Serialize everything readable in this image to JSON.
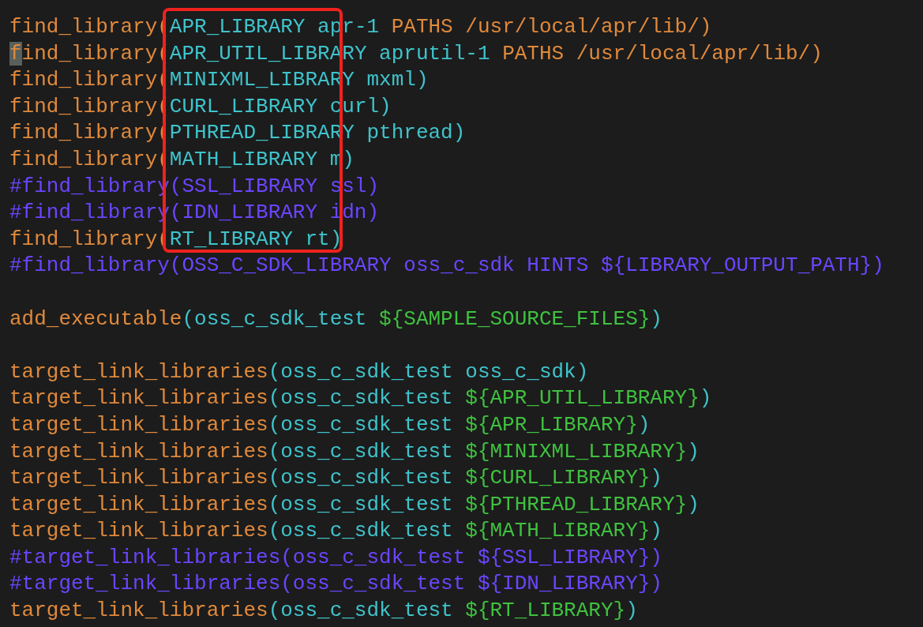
{
  "editor": {
    "lines": [
      {
        "kind": "code",
        "tokens": [
          {
            "kind": "function",
            "text": "find_library("
          },
          {
            "kind": "argument",
            "text": "APR_LIBRARY apr-1 "
          },
          {
            "kind": "keyword",
            "text": "PATHS /usr/local/apr/lib/)"
          }
        ]
      },
      {
        "kind": "code",
        "tokens": [
          {
            "kind": "cursor",
            "text": "f"
          },
          {
            "kind": "function",
            "text": "ind_library("
          },
          {
            "kind": "argument",
            "text": "APR_UTIL_LIBRARY aprutil-1 "
          },
          {
            "kind": "keyword",
            "text": "PATHS /usr/local/apr/lib/)"
          }
        ]
      },
      {
        "kind": "code",
        "tokens": [
          {
            "kind": "function",
            "text": "find_library("
          },
          {
            "kind": "argument",
            "text": "MINIXML_LIBRARY mxml)"
          }
        ]
      },
      {
        "kind": "code",
        "tokens": [
          {
            "kind": "function",
            "text": "find_library("
          },
          {
            "kind": "argument",
            "text": "CURL_LIBRARY curl)"
          }
        ]
      },
      {
        "kind": "code",
        "tokens": [
          {
            "kind": "function",
            "text": "find_library("
          },
          {
            "kind": "argument",
            "text": "PTHREAD_LIBRARY pthread)"
          }
        ]
      },
      {
        "kind": "code",
        "tokens": [
          {
            "kind": "function",
            "text": "find_library("
          },
          {
            "kind": "argument",
            "text": "MATH_LIBRARY m)"
          }
        ]
      },
      {
        "kind": "code",
        "tokens": [
          {
            "kind": "comment",
            "text": "#find_library(SSL_LIBRARY ssl)"
          }
        ]
      },
      {
        "kind": "code",
        "tokens": [
          {
            "kind": "comment",
            "text": "#find_library(IDN_LIBRARY idn)"
          }
        ]
      },
      {
        "kind": "code",
        "tokens": [
          {
            "kind": "function",
            "text": "find_library("
          },
          {
            "kind": "argument",
            "text": "RT_LIBRARY rt)"
          }
        ]
      },
      {
        "kind": "code",
        "tokens": [
          {
            "kind": "comment",
            "text": "#find_library(OSS_C_SDK_LIBRARY oss_c_sdk HINTS ${LIBRARY_OUTPUT_PATH})"
          }
        ]
      },
      {
        "kind": "blank"
      },
      {
        "kind": "code",
        "tokens": [
          {
            "kind": "function",
            "text": "add_executable"
          },
          {
            "kind": "argument",
            "text": "(oss_c_sdk_test "
          },
          {
            "kind": "variable",
            "text": "${SAMPLE_SOURCE_FILES}"
          },
          {
            "kind": "argument",
            "text": ")"
          }
        ]
      },
      {
        "kind": "blank"
      },
      {
        "kind": "code",
        "tokens": [
          {
            "kind": "function",
            "text": "target_link_libraries"
          },
          {
            "kind": "argument",
            "text": "(oss_c_sdk_test oss_c_sdk)"
          }
        ]
      },
      {
        "kind": "code",
        "tokens": [
          {
            "kind": "function",
            "text": "target_link_libraries"
          },
          {
            "kind": "argument",
            "text": "(oss_c_sdk_test "
          },
          {
            "kind": "variable",
            "text": "${APR_UTIL_LIBRARY}"
          },
          {
            "kind": "argument",
            "text": ")"
          }
        ]
      },
      {
        "kind": "code",
        "tokens": [
          {
            "kind": "function",
            "text": "target_link_libraries"
          },
          {
            "kind": "argument",
            "text": "(oss_c_sdk_test "
          },
          {
            "kind": "variable",
            "text": "${APR_LIBRARY}"
          },
          {
            "kind": "argument",
            "text": ")"
          }
        ]
      },
      {
        "kind": "code",
        "tokens": [
          {
            "kind": "function",
            "text": "target_link_libraries"
          },
          {
            "kind": "argument",
            "text": "(oss_c_sdk_test "
          },
          {
            "kind": "variable",
            "text": "${MINIXML_LIBRARY}"
          },
          {
            "kind": "argument",
            "text": ")"
          }
        ]
      },
      {
        "kind": "code",
        "tokens": [
          {
            "kind": "function",
            "text": "target_link_libraries"
          },
          {
            "kind": "argument",
            "text": "(oss_c_sdk_test "
          },
          {
            "kind": "variable",
            "text": "${CURL_LIBRARY}"
          },
          {
            "kind": "argument",
            "text": ")"
          }
        ]
      },
      {
        "kind": "code",
        "tokens": [
          {
            "kind": "function",
            "text": "target_link_libraries"
          },
          {
            "kind": "argument",
            "text": "(oss_c_sdk_test "
          },
          {
            "kind": "variable",
            "text": "${PTHREAD_LIBRARY}"
          },
          {
            "kind": "argument",
            "text": ")"
          }
        ]
      },
      {
        "kind": "code",
        "tokens": [
          {
            "kind": "function",
            "text": "target_link_libraries"
          },
          {
            "kind": "argument",
            "text": "(oss_c_sdk_test "
          },
          {
            "kind": "variable",
            "text": "${MATH_LIBRARY}"
          },
          {
            "kind": "argument",
            "text": ")"
          }
        ]
      },
      {
        "kind": "code",
        "tokens": [
          {
            "kind": "comment",
            "text": "#target_link_libraries(oss_c_sdk_test ${SSL_LIBRARY})"
          }
        ]
      },
      {
        "kind": "code",
        "tokens": [
          {
            "kind": "comment",
            "text": "#target_link_libraries(oss_c_sdk_test ${IDN_LIBRARY})"
          }
        ]
      },
      {
        "kind": "code",
        "tokens": [
          {
            "kind": "function",
            "text": "target_link_libraries"
          },
          {
            "kind": "argument",
            "text": "(oss_c_sdk_test "
          },
          {
            "kind": "variable",
            "text": "${RT_LIBRARY}"
          },
          {
            "kind": "argument",
            "text": ")"
          }
        ]
      }
    ]
  }
}
